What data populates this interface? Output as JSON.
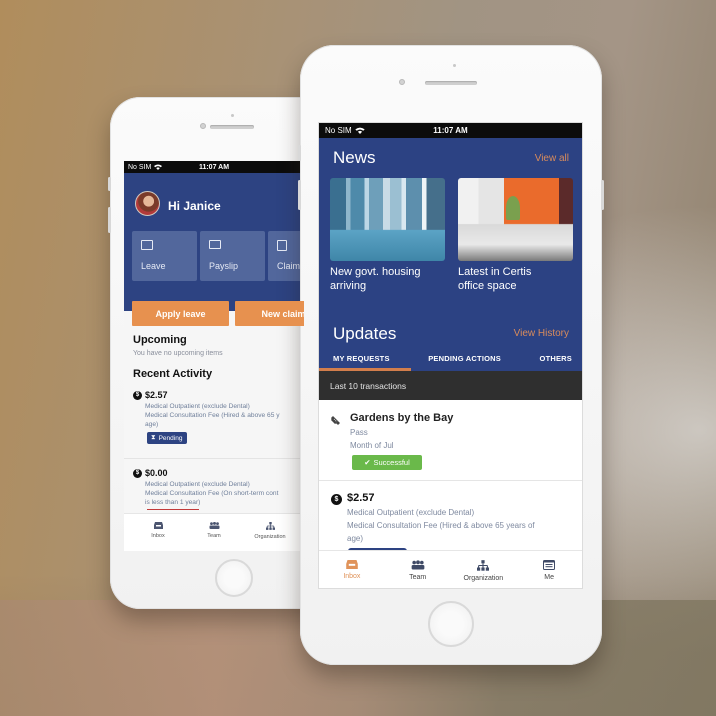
{
  "colors": {
    "header_blue": "#2c4283",
    "accent_orange": "#e7914f",
    "success_green": "#6ab94a",
    "dark_banner": "#2f2f2f"
  },
  "back_phone": {
    "status_bar": {
      "carrier": "No SIM",
      "time": "11:07 AM",
      "wifi_icon": "wifi-icon"
    },
    "greeting": "Hi Janice",
    "tiles": [
      {
        "label": "Leave",
        "icon": "calendar-icon"
      },
      {
        "label": "Payslip",
        "icon": "payslip-icon"
      },
      {
        "label": "Claim",
        "icon": "claim-icon"
      }
    ],
    "pager": {
      "pages": 2,
      "active": 1
    },
    "actions": [
      {
        "label": "Apply leave"
      },
      {
        "label": "New claim"
      }
    ],
    "upcoming": {
      "title": "Upcoming",
      "empty_text": "You have no upcoming items"
    },
    "recent_activity": {
      "title": "Recent Activity",
      "items": [
        {
          "amount": "$2.57",
          "line1": "Medical Outpatient (exclude Dental)",
          "line2": "Medical Consultation Fee (Hired & above 65 y",
          "line3": "age)",
          "status": "Pending"
        },
        {
          "amount": "$0.00",
          "line1": "Medical Outpatient (exclude Dental)",
          "line2": "Medical Consultation Fee (On short-term cont",
          "line3": "is less than 1 year)"
        }
      ]
    },
    "tabbar": [
      {
        "label": "Inbox",
        "icon": "inbox-icon"
      },
      {
        "label": "Team",
        "icon": "team-icon"
      },
      {
        "label": "Organization",
        "icon": "organization-icon"
      }
    ]
  },
  "front_phone": {
    "status_bar": {
      "carrier": "No SIM",
      "time": "11:07 AM",
      "wifi_icon": "wifi-icon"
    },
    "news": {
      "title": "News",
      "view_all": "View all",
      "cards": [
        {
          "caption_line1": "New govt. housing",
          "caption_line2": "arriving",
          "image": "city-buildings-photo"
        },
        {
          "caption_line1": "Latest in Certis",
          "caption_line2": "office space",
          "image": "office-interior-photo"
        }
      ]
    },
    "updates": {
      "title": "Updates",
      "view_history": "View History",
      "tabs": [
        {
          "label": "MY REQUESTS",
          "active": true
        },
        {
          "label": "PENDING ACTIONS",
          "active": false
        },
        {
          "label": "OTHERS",
          "active": false
        }
      ],
      "banner": "Last 10 transactions",
      "items": [
        {
          "icon": "ticket-icon",
          "title": "Gardens by the Bay",
          "sub1": "Pass",
          "sub2": "Month of Jul",
          "status": "Successful"
        },
        {
          "icon": "dollar-icon",
          "amount": "$2.57",
          "line1": "Medical Outpatient (exclude Dental)",
          "line2": "Medical Consultation Fee (Hired & above 65 years of",
          "line3": "age)"
        }
      ]
    },
    "tabbar": [
      {
        "label": "Inbox",
        "icon": "inbox-icon",
        "active": true
      },
      {
        "label": "Team",
        "icon": "team-icon",
        "active": false
      },
      {
        "label": "Organization",
        "icon": "organization-icon",
        "active": false
      },
      {
        "label": "Me",
        "icon": "profile-card-icon",
        "active": false
      }
    ]
  }
}
